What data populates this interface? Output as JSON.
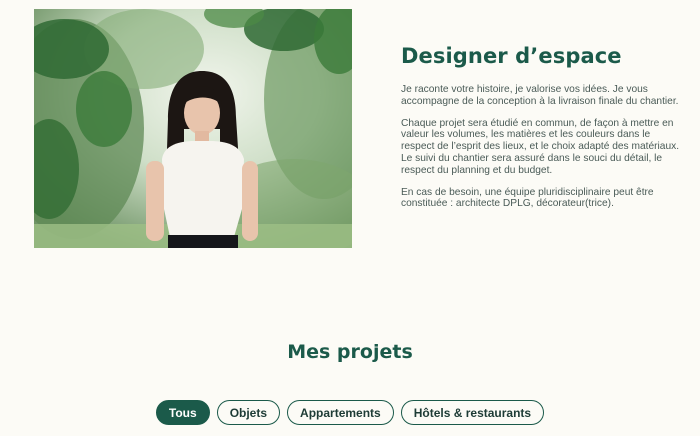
{
  "about": {
    "title": "Designer d’espace",
    "paragraphs": [
      "Je raconte votre histoire, je valorise vos idées. Je vous accompagne de la conception à la livraison finale du chantier.",
      "Chaque projet sera étudié en commun, de façon à mettre en valeur les volumes, les matières et les couleurs dans le respect de l’esprit des lieux, et le choix adapté des matériaux. Le suivi du chantier sera assuré dans le souci du détail, le respect du planning et du budget.",
      "En cas de besoin, une équipe pluridisciplinaire peut être constituée : architecte DPLG, décorateur(trice)."
    ]
  },
  "projects": {
    "title": "Mes projets",
    "filters": [
      {
        "label": "Tous",
        "active": true
      },
      {
        "label": "Objets",
        "active": false
      },
      {
        "label": "Appartements",
        "active": false
      },
      {
        "label": "Hôtels & restaurants",
        "active": false
      }
    ]
  },
  "colors": {
    "brand": "#1b5a4a",
    "background": "#fcfbf6",
    "body_text": "#4a5b57"
  }
}
